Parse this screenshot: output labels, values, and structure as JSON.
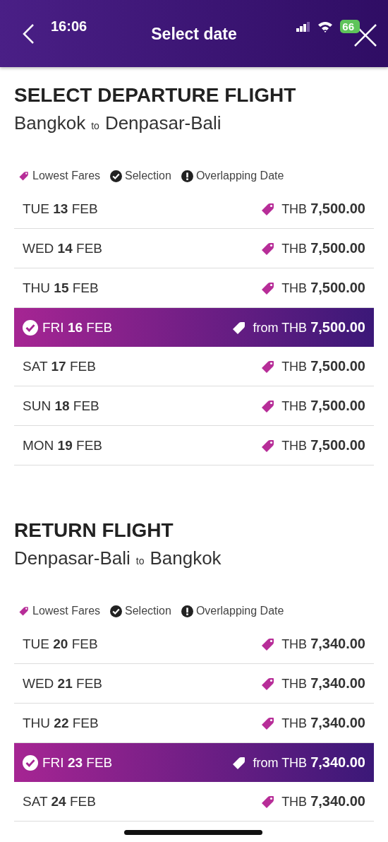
{
  "status_bar": {
    "time": "16:06",
    "battery": "66"
  },
  "header": {
    "title": "Select date"
  },
  "sections": [
    {
      "heading": "SELECT DEPARTURE FLIGHT",
      "origin": "Bangkok",
      "connector": "to",
      "destination": "Denpasar-Bali",
      "legend": [
        {
          "kind": "tag",
          "label": "Lowest Fares"
        },
        {
          "kind": "check",
          "label": "Selection"
        },
        {
          "kind": "alert",
          "label": "Overlapping Date"
        }
      ],
      "dates": [
        {
          "day": "TUE",
          "date": "13",
          "month": "FEB",
          "currency": "THB",
          "amount": "7,500.00",
          "selected": false
        },
        {
          "day": "WED",
          "date": "14",
          "month": "FEB",
          "currency": "THB",
          "amount": "7,500.00",
          "selected": false
        },
        {
          "day": "THU",
          "date": "15",
          "month": "FEB",
          "currency": "THB",
          "amount": "7,500.00",
          "selected": false
        },
        {
          "day": "FRI",
          "date": "16",
          "month": "FEB",
          "prefix": "from",
          "currency": "THB",
          "amount": "7,500.00",
          "selected": true
        },
        {
          "day": "SAT",
          "date": "17",
          "month": "FEB",
          "currency": "THB",
          "amount": "7,500.00",
          "selected": false
        },
        {
          "day": "SUN",
          "date": "18",
          "month": "FEB",
          "currency": "THB",
          "amount": "7,500.00",
          "selected": false
        },
        {
          "day": "MON",
          "date": "19",
          "month": "FEB",
          "currency": "THB",
          "amount": "7,500.00",
          "selected": false
        }
      ]
    },
    {
      "heading": "RETURN FLIGHT",
      "origin": "Denpasar-Bali",
      "connector": "to",
      "destination": "Bangkok",
      "legend": [
        {
          "kind": "tag",
          "label": "Lowest Fares"
        },
        {
          "kind": "check",
          "label": "Selection"
        },
        {
          "kind": "alert",
          "label": "Overlapping Date"
        }
      ],
      "dates": [
        {
          "day": "TUE",
          "date": "20",
          "month": "FEB",
          "currency": "THB",
          "amount": "7,340.00",
          "selected": false
        },
        {
          "day": "WED",
          "date": "21",
          "month": "FEB",
          "currency": "THB",
          "amount": "7,340.00",
          "selected": false
        },
        {
          "day": "THU",
          "date": "22",
          "month": "FEB",
          "currency": "THB",
          "amount": "7,340.00",
          "selected": false
        },
        {
          "day": "FRI",
          "date": "23",
          "month": "FEB",
          "prefix": "from",
          "currency": "THB",
          "amount": "7,340.00",
          "selected": true
        },
        {
          "day": "SAT",
          "date": "24",
          "month": "FEB",
          "currency": "THB",
          "amount": "7,340.00",
          "selected": false
        }
      ]
    }
  ]
}
